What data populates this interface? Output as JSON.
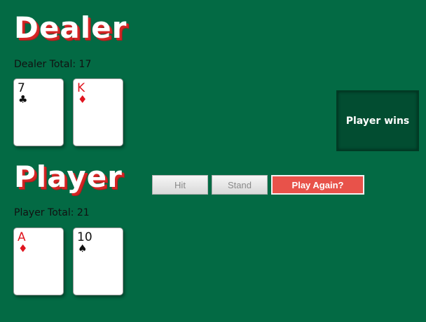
{
  "dealer": {
    "title": "Dealer",
    "total_text": "Dealer Total: 17",
    "cards": [
      {
        "rank": "7",
        "suit": "♣",
        "color": "black"
      },
      {
        "rank": "K",
        "suit": "♦",
        "color": "red"
      }
    ]
  },
  "player": {
    "title": "Player",
    "total_text": "Player Total: 21",
    "cards": [
      {
        "rank": "A",
        "suit": "♦",
        "color": "red"
      },
      {
        "rank": "10",
        "suit": "♠",
        "color": "black"
      }
    ]
  },
  "controls": {
    "hit_label": "Hit",
    "stand_label": "Stand",
    "play_again_label": "Play Again?"
  },
  "result": {
    "message": "Player wins"
  },
  "colors": {
    "table": "#036a44",
    "title_shadow": "#d42525",
    "card_red": "#e0141e",
    "card_black": "#111111",
    "play_again": "#e8524a",
    "result_box": "#024d31"
  }
}
